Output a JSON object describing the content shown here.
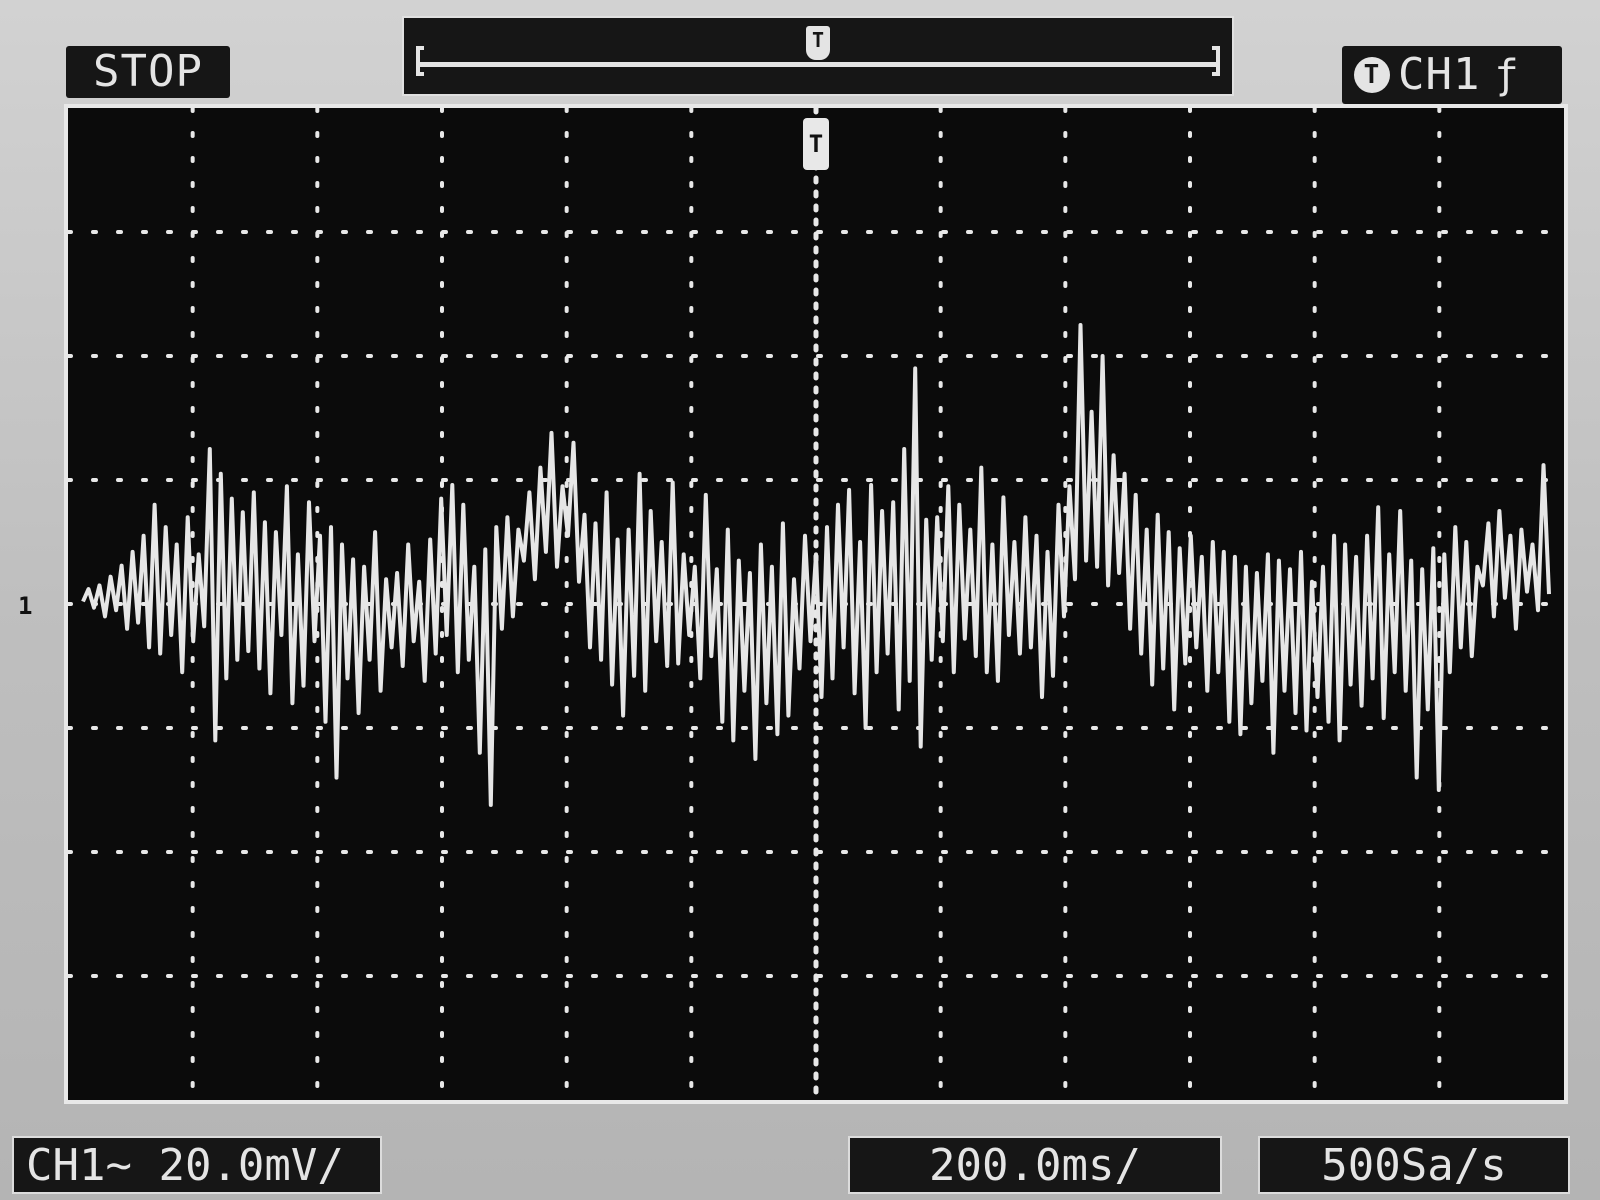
{
  "status": {
    "run_state": "STOP"
  },
  "trigger": {
    "icon": "trigger-t-icon",
    "marker_label": "T",
    "source": "CH1",
    "edge_icon": "rising-edge-icon",
    "edge_glyph": "ƒ"
  },
  "channel": {
    "marker_label": "1"
  },
  "settings": {
    "ch_scale": "CH1∼ 20.0mV/",
    "time_base": "200.0ms/",
    "sample_rate": "500Sa/s"
  },
  "colors": {
    "screen_bg": "#0b0b0b",
    "trace": "#e6e6e6",
    "grid": "#e8e8e8",
    "bezel": "#bdbdbd"
  },
  "chart_data": {
    "type": "line",
    "title": "",
    "xlabel": "",
    "ylabel": "",
    "x_divisions": 12,
    "y_divisions": 8,
    "xlim": [
      -6,
      6
    ],
    "ylim": [
      -4,
      4
    ],
    "grid": true,
    "series": [
      {
        "values": [
          0.02,
          0.12,
          -0.03,
          0.15,
          -0.1,
          0.22,
          -0.05,
          0.31,
          -0.2,
          0.42,
          -0.15,
          0.55,
          -0.35,
          0.8,
          -0.4,
          0.62,
          -0.25,
          0.48,
          -0.55,
          0.7,
          -0.3,
          0.4,
          -0.18,
          1.25,
          -1.1,
          1.05,
          -0.6,
          0.85,
          -0.45,
          0.74,
          -0.38,
          0.9,
          -0.52,
          0.66,
          -0.72,
          0.58,
          -0.25,
          0.95,
          -0.8,
          0.4,
          -0.66,
          0.82,
          -0.3,
          0.55,
          -0.95,
          0.62,
          -1.4,
          0.48,
          -0.6,
          0.36,
          -0.88,
          0.3,
          -0.45,
          0.58,
          -0.7,
          0.2,
          -0.35,
          0.25,
          -0.5,
          0.48,
          -0.3,
          0.18,
          -0.62,
          0.52,
          -0.4,
          0.85,
          -0.25,
          0.96,
          -0.55,
          0.8,
          -0.45,
          0.3,
          -1.2,
          0.44,
          -1.62,
          0.62,
          -0.2,
          0.7,
          -0.1,
          0.6,
          0.35,
          0.9,
          0.2,
          1.1,
          0.42,
          1.38,
          0.3,
          0.95,
          0.55,
          1.3,
          0.18,
          0.72,
          -0.35,
          0.65,
          -0.45,
          0.9,
          -0.65,
          0.52,
          -0.9,
          0.6,
          -0.58,
          1.05,
          -0.7,
          0.75,
          -0.3,
          0.5,
          -0.5,
          0.98,
          -0.48,
          0.4,
          -0.25,
          0.3,
          -0.6,
          0.88,
          -0.42,
          0.28,
          -0.95,
          0.6,
          -1.1,
          0.35,
          -0.7,
          0.25,
          -1.25,
          0.48,
          -0.8,
          0.3,
          -1.05,
          0.65,
          -0.9,
          0.2,
          -0.52,
          0.55,
          -0.3,
          0.4,
          -0.75,
          0.62,
          -0.6,
          0.8,
          -0.35,
          0.92,
          -0.72,
          0.5,
          -1.0,
          0.96,
          -0.55,
          0.75,
          -0.4,
          0.82,
          -0.85,
          1.25,
          -0.62,
          1.9,
          -1.15,
          0.68,
          -0.45,
          0.7,
          -0.3,
          0.95,
          -0.55,
          0.8,
          -0.28,
          0.6,
          -0.42,
          1.1,
          -0.55,
          0.48,
          -0.62,
          0.86,
          -0.25,
          0.5,
          -0.4,
          0.7,
          -0.35,
          0.55,
          -0.75,
          0.42,
          -0.58,
          0.8,
          -0.1,
          0.95,
          0.2,
          2.25,
          0.35,
          1.55,
          0.3,
          2.0,
          0.15,
          1.2,
          0.25,
          1.05,
          -0.2,
          0.88,
          -0.4,
          0.6,
          -0.65,
          0.72,
          -0.52,
          0.58,
          -0.85,
          0.45,
          -0.48,
          0.55,
          -0.35,
          0.38,
          -0.7,
          0.5,
          -0.55,
          0.42,
          -0.95,
          0.38,
          -1.05,
          0.3,
          -0.8,
          0.25,
          -0.62,
          0.4,
          -1.2,
          0.35,
          -0.7,
          0.28,
          -0.88,
          0.42,
          -1.02,
          0.18,
          -0.75,
          0.3,
          -0.95,
          0.55,
          -1.1,
          0.48,
          -0.65,
          0.38,
          -0.82,
          0.55,
          -0.6,
          0.78,
          -0.92,
          0.4,
          -0.55,
          0.75,
          -0.7,
          0.35,
          -1.4,
          0.28,
          -0.85,
          0.45,
          -1.5,
          0.4,
          -0.55,
          0.62,
          -0.35,
          0.5,
          -0.42,
          0.3,
          0.15,
          0.65,
          -0.1,
          0.75,
          0.05,
          0.55,
          -0.2,
          0.6,
          0.1,
          0.48,
          -0.05,
          1.12,
          0.08
        ]
      }
    ]
  }
}
